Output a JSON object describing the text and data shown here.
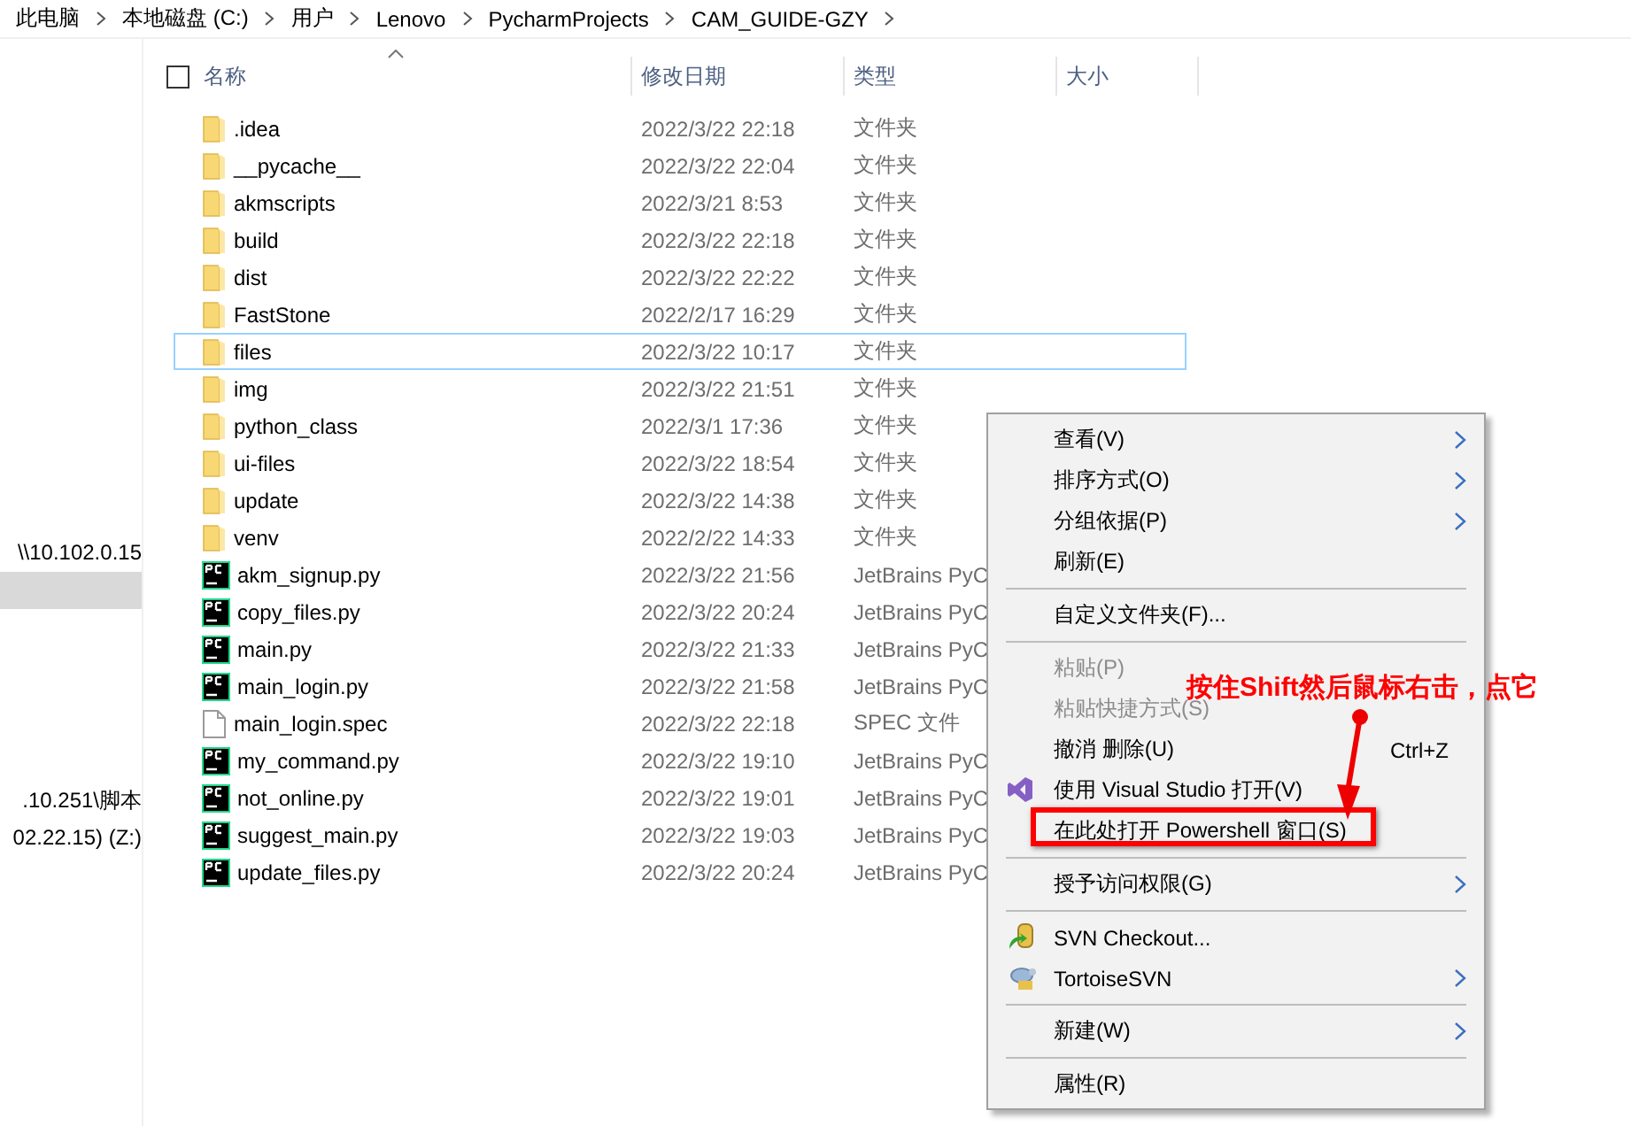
{
  "breadcrumb": [
    "此电脑",
    "本地磁盘 (C:)",
    "用户",
    "Lenovo",
    "PycharmProjects",
    "CAM_GUIDE-GZY"
  ],
  "nav_pane": {
    "groups": [
      [
        {
          "label": "\\\\10.102.0.15",
          "selected": false
        },
        {
          "selected": true
        }
      ],
      [
        {
          "label": ".10.251\\脚本",
          "selected": false
        },
        {
          "label": "02.22.15) (Z:)",
          "selected": false
        }
      ]
    ]
  },
  "select_all": {
    "checked": false
  },
  "columns": [
    {
      "label": "名称",
      "sorted": true
    },
    {
      "label": "修改日期",
      "sorted": false
    },
    {
      "label": "类型",
      "sorted": false
    },
    {
      "label": "大小",
      "sorted": false
    }
  ],
  "files": [
    {
      "kind": "folder",
      "name": ".idea",
      "modified": "2022/3/22 22:18",
      "type": "文件夹",
      "selected": false
    },
    {
      "kind": "folder",
      "name": "__pycache__",
      "modified": "2022/3/22 22:04",
      "type": "文件夹",
      "selected": false
    },
    {
      "kind": "folder",
      "name": "akmscripts",
      "modified": "2022/3/21 8:53",
      "type": "文件夹",
      "selected": false
    },
    {
      "kind": "folder",
      "name": "build",
      "modified": "2022/3/22 22:18",
      "type": "文件夹",
      "selected": false
    },
    {
      "kind": "folder",
      "name": "dist",
      "modified": "2022/3/22 22:22",
      "type": "文件夹",
      "selected": false
    },
    {
      "kind": "folder",
      "name": "FastStone",
      "modified": "2022/2/17 16:29",
      "type": "文件夹",
      "selected": false
    },
    {
      "kind": "folder",
      "name": "files",
      "modified": "2022/3/22 10:17",
      "type": "文件夹",
      "selected": true
    },
    {
      "kind": "folder",
      "name": "img",
      "modified": "2022/3/22 21:51",
      "type": "文件夹",
      "selected": false
    },
    {
      "kind": "folder",
      "name": "python_class",
      "modified": "2022/3/1 17:36",
      "type": "文件夹",
      "selected": false
    },
    {
      "kind": "folder",
      "name": "ui-files",
      "modified": "2022/3/22 18:54",
      "type": "文件夹",
      "selected": false
    },
    {
      "kind": "folder",
      "name": "update",
      "modified": "2022/3/22 14:38",
      "type": "文件夹",
      "selected": false
    },
    {
      "kind": "folder",
      "name": "venv",
      "modified": "2022/2/22 14:33",
      "type": "文件夹",
      "selected": false
    },
    {
      "kind": "python",
      "name": "akm_signup.py",
      "modified": "2022/3/22 21:56",
      "type": "JetBrains PyC",
      "selected": false
    },
    {
      "kind": "python",
      "name": "copy_files.py",
      "modified": "2022/3/22 20:24",
      "type": "JetBrains PyC",
      "selected": false
    },
    {
      "kind": "python",
      "name": "main.py",
      "modified": "2022/3/22 21:33",
      "type": "JetBrains PyC",
      "selected": false
    },
    {
      "kind": "python",
      "name": "main_login.py",
      "modified": "2022/3/22 21:58",
      "type": "JetBrains PyC",
      "selected": false
    },
    {
      "kind": "file",
      "name": "main_login.spec",
      "modified": "2022/3/22 22:18",
      "type": "SPEC 文件",
      "selected": false
    },
    {
      "kind": "python",
      "name": "my_command.py",
      "modified": "2022/3/22 19:10",
      "type": "JetBrains PyC",
      "selected": false
    },
    {
      "kind": "python",
      "name": "not_online.py",
      "modified": "2022/3/22 19:01",
      "type": "JetBrains PyC",
      "selected": false
    },
    {
      "kind": "python",
      "name": "suggest_main.py",
      "modified": "2022/3/22 19:03",
      "type": "JetBrains PyC",
      "selected": false
    },
    {
      "kind": "python",
      "name": "update_files.py",
      "modified": "2022/3/22 20:24",
      "type": "JetBrains PyC",
      "selected": false
    }
  ],
  "context_menu": [
    {
      "kind": "item",
      "label": "查看(V)",
      "submenu": true,
      "disabled": false,
      "highlighted": false
    },
    {
      "kind": "item",
      "label": "排序方式(O)",
      "submenu": true,
      "disabled": false,
      "highlighted": false
    },
    {
      "kind": "item",
      "label": "分组依据(P)",
      "submenu": true,
      "disabled": false,
      "highlighted": false
    },
    {
      "kind": "item",
      "label": "刷新(E)",
      "submenu": false,
      "disabled": false,
      "highlighted": false
    },
    {
      "kind": "separator"
    },
    {
      "kind": "item",
      "label": "自定义文件夹(F)...",
      "submenu": false,
      "disabled": false,
      "highlighted": false
    },
    {
      "kind": "separator"
    },
    {
      "kind": "item",
      "label": "粘贴(P)",
      "submenu": false,
      "disabled": true,
      "highlighted": false
    },
    {
      "kind": "item",
      "label": "粘贴快捷方式(S)",
      "submenu": false,
      "disabled": true,
      "highlighted": false
    },
    {
      "kind": "item",
      "label": "撤消 删除(U)",
      "shortcut": "Ctrl+Z",
      "submenu": false,
      "disabled": false,
      "highlighted": false
    },
    {
      "kind": "item",
      "label": "使用 Visual Studio 打开(V)",
      "submenu": false,
      "disabled": false,
      "highlighted": false
    },
    {
      "kind": "item",
      "label": "在此处打开 Powershell 窗口(S)",
      "submenu": false,
      "disabled": false,
      "highlighted": true
    },
    {
      "kind": "separator"
    },
    {
      "kind": "item",
      "label": "授予访问权限(G)",
      "submenu": true,
      "disabled": false,
      "highlighted": false
    },
    {
      "kind": "separator"
    },
    {
      "kind": "item",
      "label": "SVN Checkout...",
      "submenu": false,
      "disabled": false,
      "highlighted": false
    },
    {
      "kind": "item",
      "label": "TortoiseSVN",
      "submenu": true,
      "disabled": false,
      "highlighted": false
    },
    {
      "kind": "separator"
    },
    {
      "kind": "item",
      "label": "新建(W)",
      "submenu": true,
      "disabled": false,
      "highlighted": false
    },
    {
      "kind": "separator"
    },
    {
      "kind": "item",
      "label": "属性(R)",
      "submenu": false,
      "disabled": false,
      "highlighted": false
    }
  ],
  "annotation": {
    "text": "按住Shift然后鼠标右击，点它"
  }
}
